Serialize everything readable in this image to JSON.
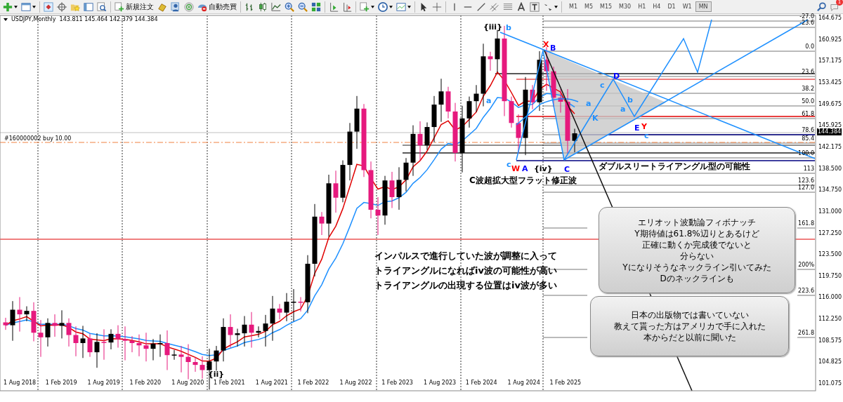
{
  "toolbar": {
    "order_buttons": [
      {
        "label": "新規注文"
      },
      {
        "label": "自動売買"
      }
    ],
    "timeframes": [
      {
        "label": "M1",
        "selected": false
      },
      {
        "label": "M5",
        "selected": false
      },
      {
        "label": "M15",
        "selected": false
      },
      {
        "label": "M30",
        "selected": false
      },
      {
        "label": "H1",
        "selected": false
      },
      {
        "label": "H4",
        "selected": false
      },
      {
        "label": "D1",
        "selected": false
      },
      {
        "label": "W1",
        "selected": false
      },
      {
        "label": "MN",
        "selected": true
      }
    ],
    "notification_count": "1"
  },
  "chart": {
    "symbol": "USDJPY,Monthly",
    "ohlc": "143.811 145.464 142.379 144.384",
    "order_line": "#160000002 buy 10.00",
    "price_axis": [
      "164.675",
      "160.925",
      "157.175",
      "153.425",
      "149.675",
      "145.925",
      "142.175",
      "138.500",
      "134.750",
      "131.000",
      "127.250",
      "123.500",
      "119.750",
      "116.000",
      "112.250",
      "108.575",
      "104.825",
      "101.075"
    ],
    "current_price": "144.384",
    "date_axis": [
      "1 Aug 2018",
      "1 Feb 2019",
      "1 Aug 2019",
      "1 Feb 2020",
      "1 Aug 2020",
      "1 Feb 2021",
      "1 Aug 2021",
      "1 Feb 2022",
      "1 Aug 2022",
      "1 Feb 2023",
      "1 Aug 2023",
      "1 Feb 2024",
      "1 Aug 2024",
      "1 Feb 2025"
    ],
    "fib_levels": [
      "-27.0",
      "-23.6",
      "0.0",
      "23.6",
      "38.2",
      "50.0",
      "61.8",
      "78.6",
      "85.4",
      "100.0",
      "113",
      "123.6",
      "127.0",
      "161.8",
      "200%",
      "223.6",
      "261.8"
    ],
    "wave_labels": [
      {
        "text": "{iii}",
        "color": "#000000"
      },
      {
        "text": "b",
        "color": "#1e90ff"
      },
      {
        "text": "X",
        "color": "#ff0000"
      },
      {
        "text": "B",
        "color": "#0000ff"
      },
      {
        "text": "a",
        "color": "#1e90ff"
      },
      {
        "text": "a",
        "color": "#1e90ff"
      },
      {
        "text": "c",
        "color": "#1e90ff"
      },
      {
        "text": "D",
        "color": "#0000ff"
      },
      {
        "text": "b",
        "color": "#1e90ff"
      },
      {
        "text": "a",
        "color": "#1e90ff"
      },
      {
        "text": "K",
        "color": "#1e90ff"
      },
      {
        "text": "E",
        "color": "#0000ff"
      },
      {
        "text": "Y",
        "color": "#ff0000"
      },
      {
        "text": "c",
        "color": "#1e90ff"
      },
      {
        "text": "c",
        "color": "#1e90ff"
      },
      {
        "text": "W",
        "color": "#ff0000"
      },
      {
        "text": "A",
        "color": "#0000ff"
      },
      {
        "text": "{iv}",
        "color": "#000000"
      },
      {
        "text": "C",
        "color": "#0000ff"
      },
      {
        "text": "{ii}",
        "color": "#000000"
      }
    ],
    "captions": [
      "ダブルスリートライアングル型の可能性",
      "C波超拡大型フラット修正波"
    ],
    "notes": [
      "インパルスで進行していた波が調整に入って",
      "トライアングルになればiv波の可能性が高い",
      "トライアングルの出現する位置はiv波が多い"
    ],
    "callouts": [
      {
        "lines": [
          "エリオット波動論フィボナッチ",
          "Y期待値は61.8%辺りとあるけど",
          "正確に動くか完成後でないと",
          "分らない",
          "Yになりそうなネックライン引いてみた",
          "Dのネックラインも"
        ]
      },
      {
        "lines": [
          "日本の出版物では書いていない",
          "教えて貰った方はアメリカで手に入れた",
          "本からだと以前に聞いた"
        ]
      }
    ]
  }
}
